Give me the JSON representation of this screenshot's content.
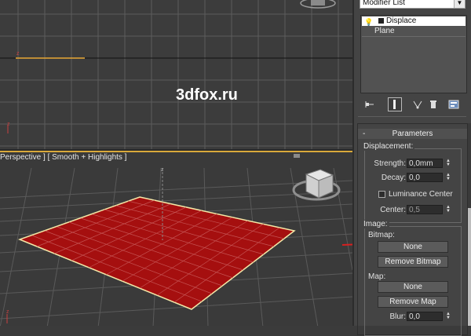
{
  "watermark": "3dfox.ru",
  "viewport_perspective": {
    "label": "Perspective ] [ Smooth + Highlights ]"
  },
  "colors": {
    "plane_fill": "#a50f0f",
    "selection_edge": "#f5e9a8",
    "active_viewport_border": "#d9a93a",
    "annotation_arrow": "#d62020"
  },
  "modifier_list": {
    "value": "Modifier List"
  },
  "stack": {
    "items": [
      {
        "label": "Displace",
        "icon": "lightbulb-icon",
        "selected": true
      },
      {
        "label": "Plane",
        "selected": false
      }
    ]
  },
  "stack_tools": {
    "icons": [
      "pin-stack-icon",
      "show-end-result-icon",
      "make-unique-icon",
      "remove-modifier-icon",
      "configure-modifier-sets-icon"
    ]
  },
  "parameters": {
    "title": "Parameters",
    "displacement": {
      "title": "Displacement:",
      "strength": {
        "label": "Strength:",
        "value": "0,0mm"
      },
      "decay": {
        "label": "Decay:",
        "value": "0,0"
      },
      "luminance_center": {
        "label": "Luminance Center",
        "checked": false
      },
      "center": {
        "label": "Center:",
        "value": "0,5"
      }
    },
    "image": {
      "title": "Image:",
      "bitmap_label": "Bitmap:",
      "bitmap_button": "None",
      "remove_bitmap": "Remove Bitmap",
      "map_label": "Map:",
      "map_button": "None",
      "remove_map": "Remove Map",
      "blur": {
        "label": "Blur:",
        "value": "0,0"
      }
    }
  }
}
